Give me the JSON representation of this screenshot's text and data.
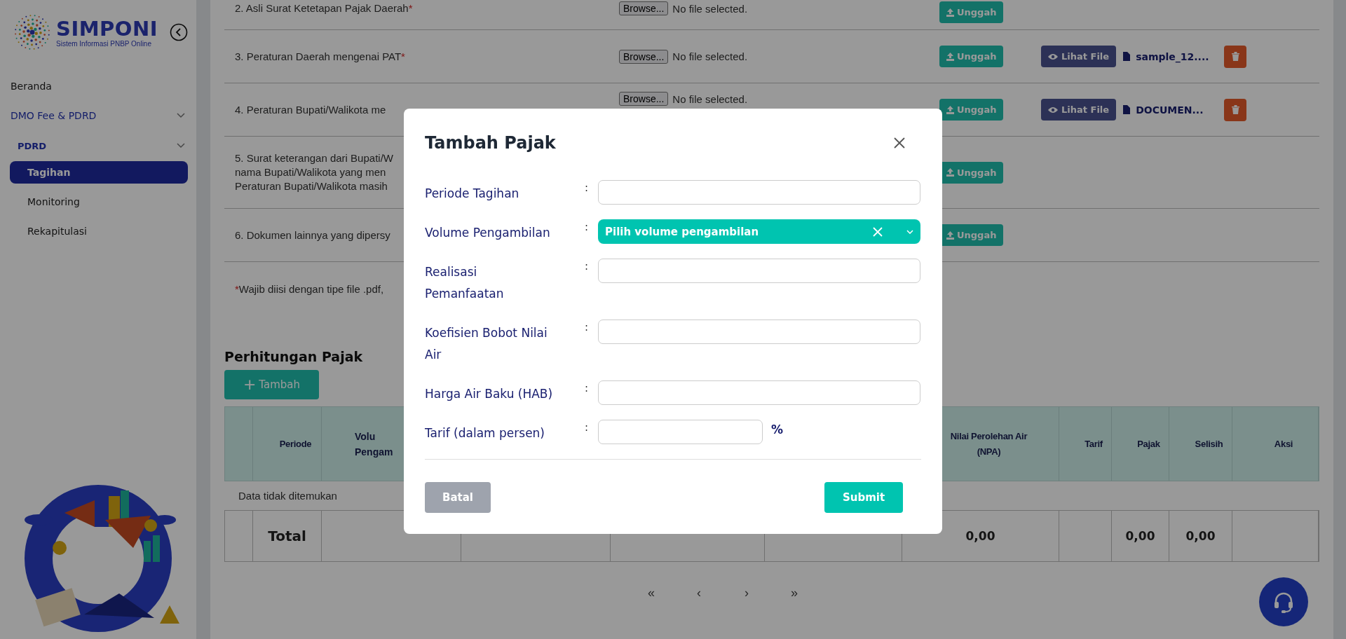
{
  "sidebar": {
    "logo": {
      "title": "SIMPONI",
      "subtitle": "Sistem Informasi PNBP Online"
    },
    "menu": [
      {
        "label": "Beranda",
        "selected": false,
        "expanded": false
      },
      {
        "label": "DMO Fee & PDRD",
        "selected": false,
        "expanded": true,
        "children": [
          {
            "label": "PDRD",
            "selected": false,
            "expanded": true,
            "children": [
              {
                "label": "Tagihan",
                "selected": true
              },
              {
                "label": "Monitoring",
                "selected": false
              },
              {
                "label": "Rekapitulasi",
                "selected": false
              }
            ]
          }
        ]
      }
    ]
  },
  "documents": [
    {
      "lines": [
        "2. Asli Surat Ketetapan Pajak Daerah"
      ],
      "required_mark": "*",
      "browse": "Browse...",
      "file_status": "No file selected.",
      "upload": "Unggah"
    },
    {
      "lines": [
        "3. Peraturan Daerah mengenai PAT"
      ],
      "required_mark": "*",
      "browse": "Browse...",
      "file_status": "No file selected.",
      "upload": "Unggah",
      "view": "Lihat File",
      "file_name": "sample_12....",
      "deletable": true
    },
    {
      "lines": [
        "4. Peraturan Bupati/Walikota me"
      ],
      "browse": "Browse...",
      "file_status": "No file selected.",
      "upload": "Unggah",
      "view": "Lihat File",
      "file_name": "DOCUMEN...",
      "deletable": true
    },
    {
      "lines": [
        "5. Surat keterangan dari Bupati/W",
        "nama Bupati/Walikota yang men",
        "Peraturan Bupati/Walikota masih"
      ],
      "upload": "Unggah"
    },
    {
      "lines": [
        "6. Dokumen lainnya yang dipersy"
      ],
      "upload": "Unggah"
    }
  ],
  "note": {
    "mark": "*",
    "text": "Wajib diisi dengan tipe file .pdf,"
  },
  "calculation": {
    "title": "Perhitungan Pajak",
    "add_button": {
      "icon": "+",
      "label": "Tambah"
    },
    "columns": [
      {
        "kind": "blank"
      },
      {
        "kind": "heading",
        "lines": [
          "Periode"
        ]
      },
      {
        "kind": "partial",
        "lines": [
          "Volu",
          "Pengam"
        ]
      },
      {
        "kind": "blank"
      },
      {
        "kind": "blank"
      },
      {
        "kind": "blank"
      },
      {
        "kind": "heading",
        "lines": [
          "Nilai Perolehan Air",
          "(NPA)"
        ]
      },
      {
        "kind": "heading",
        "lines": [
          "Tarif"
        ]
      },
      {
        "kind": "heading",
        "lines": [
          "Pajak"
        ]
      },
      {
        "kind": "heading",
        "lines": [
          "Selisih"
        ]
      },
      {
        "kind": "heading",
        "lines": [
          "Aksi"
        ]
      }
    ],
    "empty_message": "Data tidak ditemukan",
    "total_row": [
      {
        "kind": "blank"
      },
      {
        "kind": "label",
        "text": "Total"
      },
      {
        "kind": "blank"
      },
      {
        "kind": "blank"
      },
      {
        "kind": "blank"
      },
      {
        "kind": "blank"
      },
      {
        "kind": "value",
        "text": "0,00"
      },
      {
        "kind": "blank"
      },
      {
        "kind": "value",
        "text": "0,00"
      },
      {
        "kind": "value",
        "text": "0,00"
      },
      {
        "kind": "blank"
      }
    ]
  },
  "pagination": [
    "«",
    "‹",
    "›",
    "»"
  ],
  "modal": {
    "title": "Tambah Pajak",
    "fields": [
      {
        "kind": "text",
        "lines": [
          "Periode Tagihan"
        ],
        "separator": ":"
      },
      {
        "kind": "select",
        "lines": [
          "Volume Pengambilan"
        ],
        "separator": ":",
        "placeholder": "Pilih volume pengambilan"
      },
      {
        "kind": "text",
        "lines": [
          "Realisasi",
          "Pemanfaatan"
        ],
        "separator": ":"
      },
      {
        "kind": "text",
        "lines": [
          "Koefisien Bobot Nilai",
          "Air"
        ],
        "separator": ":"
      },
      {
        "kind": "text",
        "lines": [
          "Harga Air Baku (HAB)"
        ],
        "separator": ":"
      },
      {
        "kind": "percent",
        "lines": [
          "Tarif (dalam persen)"
        ],
        "separator": ":",
        "suffix": "%"
      }
    ],
    "cancel": "Batal",
    "submit": "Submit"
  }
}
